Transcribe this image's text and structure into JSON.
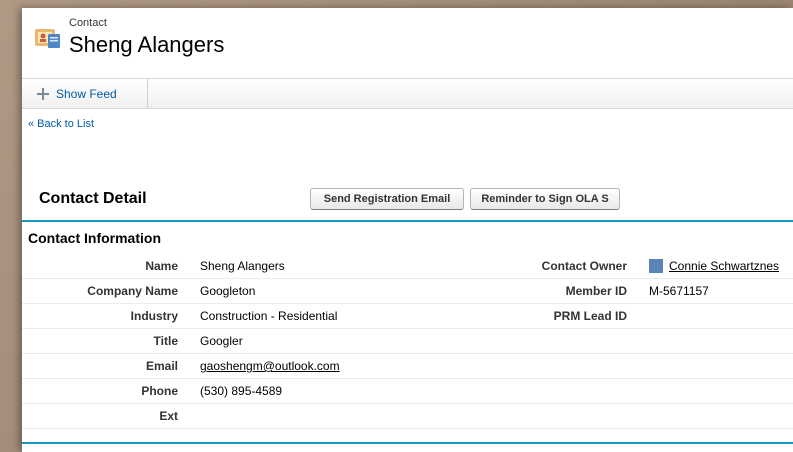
{
  "header": {
    "object_type": "Contact",
    "record_name": "Sheng Alangers"
  },
  "feedbar": {
    "show_feed_label": "Show Feed"
  },
  "nav": {
    "back_label": "« Back to List"
  },
  "detail": {
    "title": "Contact Detail",
    "buttons": {
      "send_registration": "Send Registration Email",
      "reminder_sign": "Reminder to Sign OLA S"
    },
    "section_title": "Contact Information"
  },
  "fields": {
    "name": {
      "label": "Name",
      "value": "Sheng Alangers"
    },
    "company": {
      "label": "Company Name",
      "value": "Googleton"
    },
    "industry": {
      "label": "Industry",
      "value": "Construction - Residential"
    },
    "title": {
      "label": "Title",
      "value": "Googler"
    },
    "email": {
      "label": "Email",
      "value": "gaoshengm@outlook.com"
    },
    "phone": {
      "label": "Phone",
      "value": "(530) 895-4589"
    },
    "ext": {
      "label": "Ext",
      "value": ""
    },
    "owner": {
      "label": "Contact Owner",
      "value": "Connie Schwartznes"
    },
    "member_id": {
      "label": "Member ID",
      "value": "M-5671157"
    },
    "prm_lead": {
      "label": "PRM Lead ID",
      "value": ""
    }
  },
  "colors": {
    "link": "#015ba7",
    "section_rule": "#1797c0",
    "owner_icon": "#5a83b8"
  },
  "icons": {
    "header": "contact-card-icon",
    "show_feed": "plus-icon",
    "owner": "user-icon"
  }
}
